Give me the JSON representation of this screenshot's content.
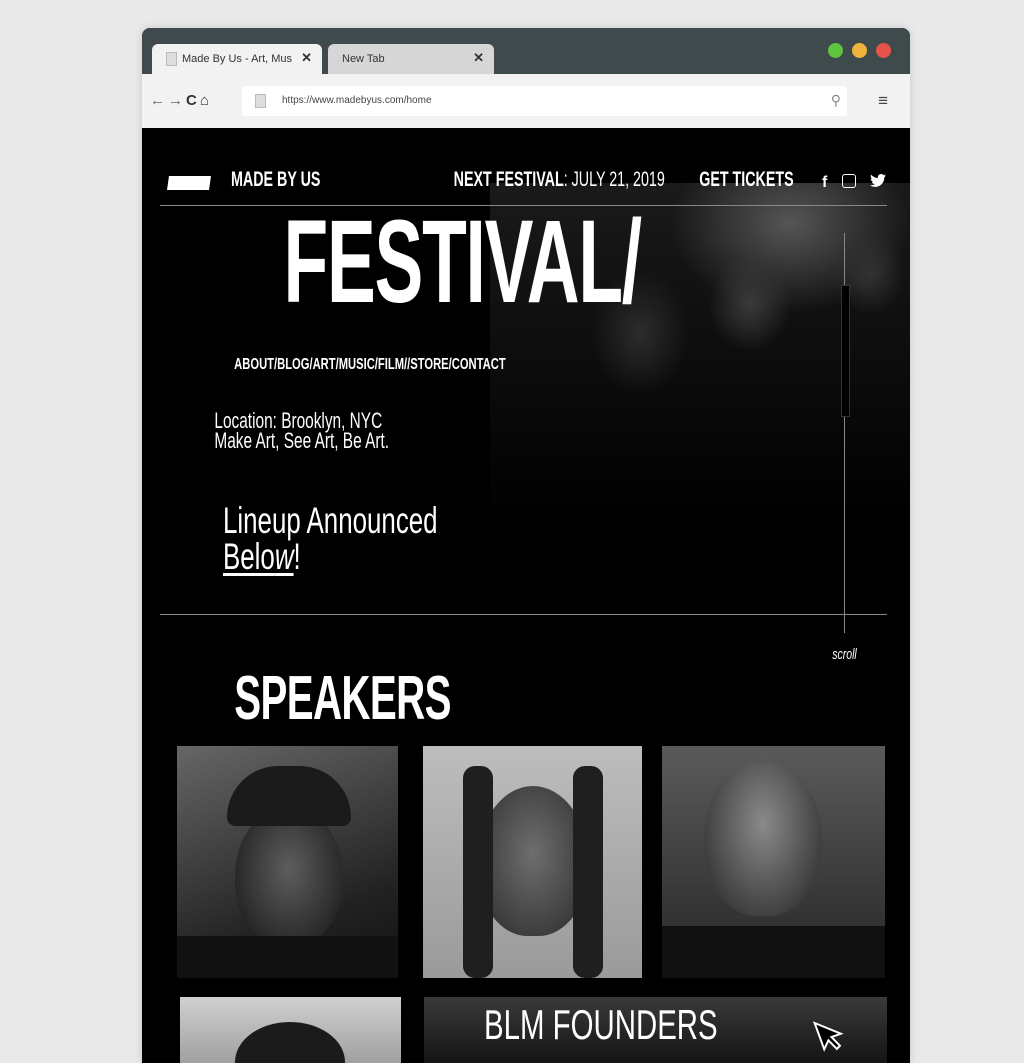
{
  "browser": {
    "tabs": [
      {
        "title": "Made By Us - Art, Music",
        "active": true
      },
      {
        "title": "New Tab",
        "active": false
      }
    ],
    "url": "https://www.madebyus.com/home",
    "traffic_lights": [
      "#5ec33f",
      "#f0b33b",
      "#e6534b"
    ]
  },
  "site": {
    "logo": "MADE BY US",
    "next_festival_label": "NEXT FESTIVAL",
    "next_festival_date": ": JULY 21, 2019",
    "get_tickets": "GET TICKETS",
    "social": {
      "facebook": "f",
      "instagram": "instagram-icon",
      "twitter": "twitter-icon"
    },
    "hero_title": "FESTIVAL/",
    "nav_links": "ABOUT/BLOG/ART/MUSIC/FILM//STORE/CONTACT",
    "location_line1": "Location: Brooklyn, NYC",
    "location_line2": "Make Art, See Art, Be Art.",
    "lineup_line1": "Lineup Announced",
    "lineup_below_start": "Belo",
    "lineup_below_w": "w",
    "lineup_bang": "!",
    "scroll_label": "scroll",
    "speakers_heading": "SPEAKERS",
    "blm_heading": "BLM FOUNDERS"
  }
}
